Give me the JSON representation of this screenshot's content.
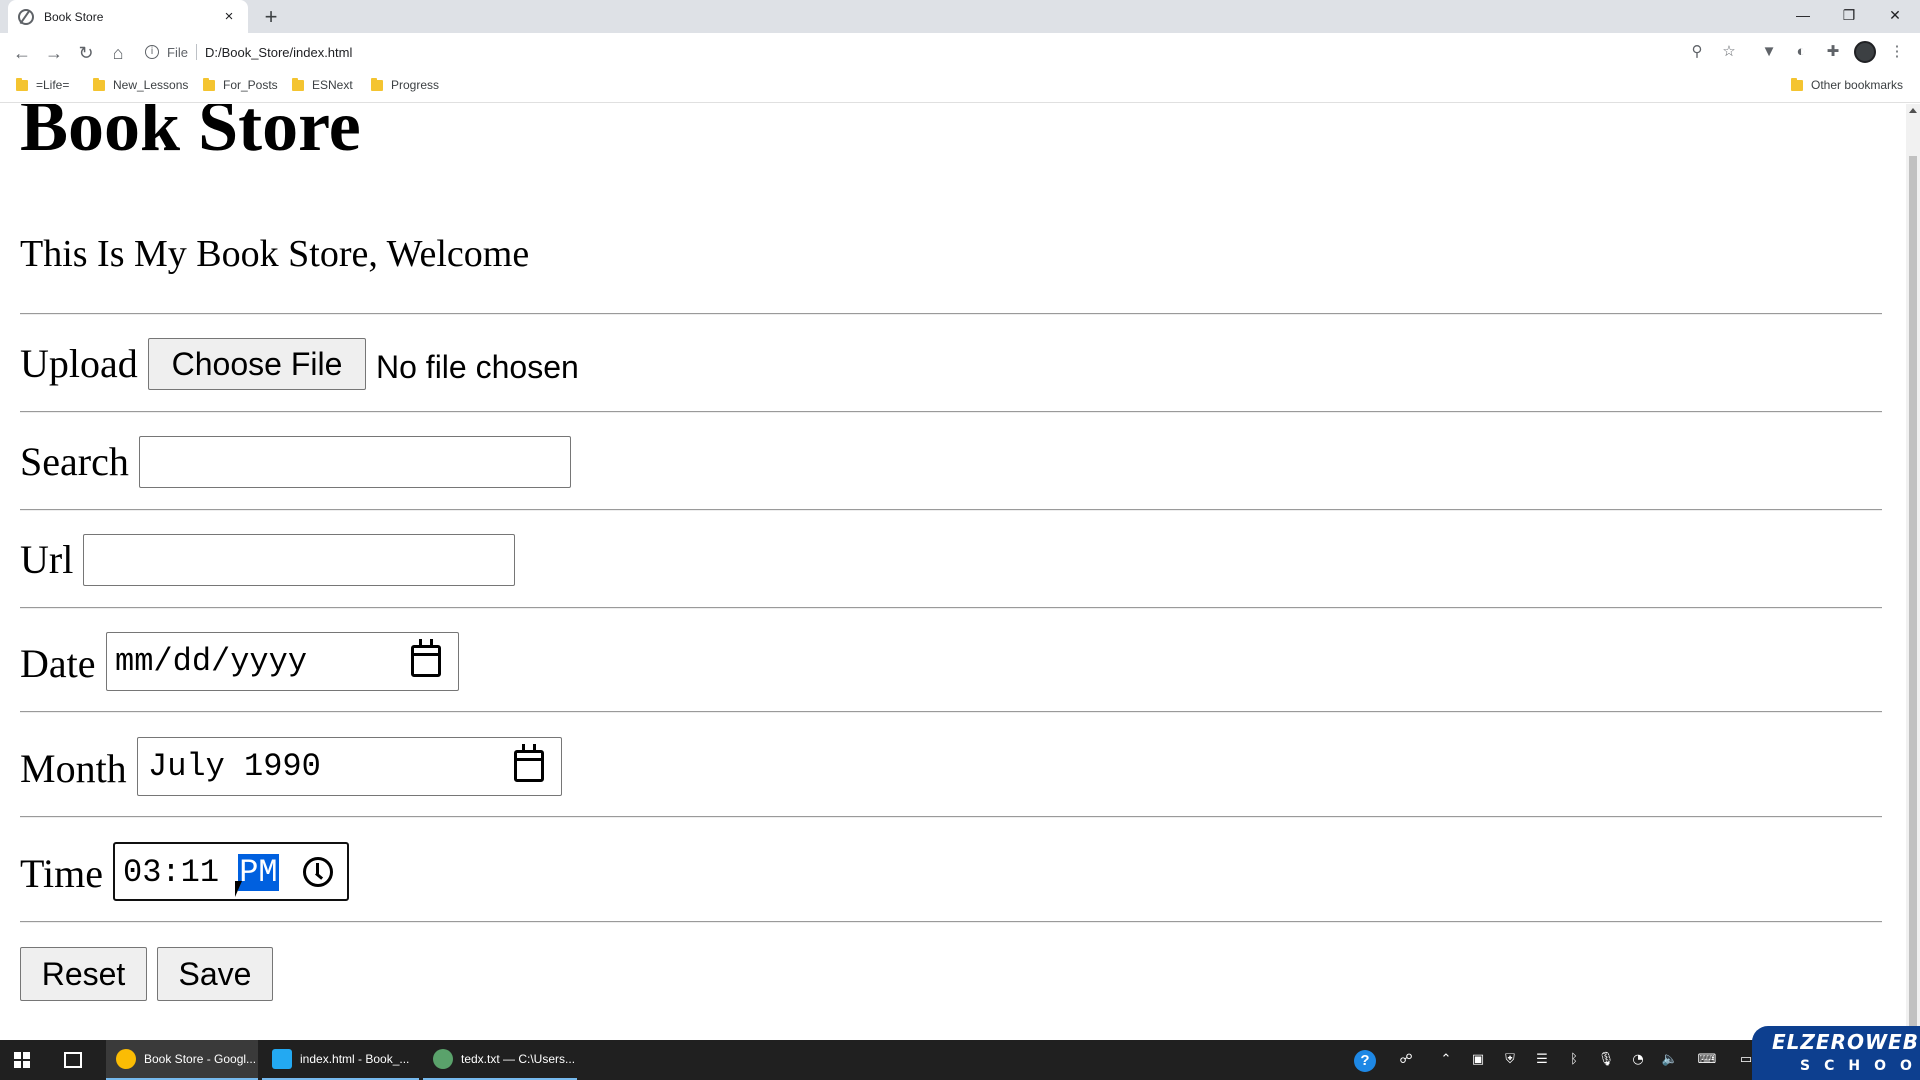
{
  "browser": {
    "tab_title": "Book Store",
    "tab_close": "×",
    "new_tab": "+",
    "window_controls": {
      "minimize": "—",
      "restore": "❐",
      "close": "✕"
    },
    "nav": {
      "back": "←",
      "forward": "→",
      "reload": "↻",
      "home": "⌂"
    },
    "address": {
      "scheme": "File",
      "url": "D:/Book_Store/index.html",
      "info_icon": "i"
    },
    "zoom_icon": "⚲",
    "star_icon": "☆",
    "extension_icons": [
      "▼",
      "◐",
      "✚"
    ],
    "menu_icon": "⋮"
  },
  "bookmarks": {
    "items": [
      "=Life=",
      "New_Lessons",
      "For_Posts",
      "ESNext",
      "Progress"
    ],
    "other": "Other bookmarks"
  },
  "page": {
    "heading": "Book Store",
    "welcome": "This Is My Book Store, Welcome",
    "upload_label": "Upload",
    "choose_file": "Choose File",
    "no_file": "No file chosen",
    "search_label": "Search",
    "url_label": "Url",
    "date_label": "Date",
    "date_placeholder": "mm/dd/yyyy",
    "month_label": "Month",
    "month_value": "July 1990",
    "time_label": "Time",
    "time_value": "03:11",
    "time_ampm": "PM",
    "reset": "Reset",
    "save": "Save"
  },
  "taskbar": {
    "items": [
      {
        "label": "Book Store - Googl...",
        "icon_color": "#fbbc04"
      },
      {
        "label": "index.html - Book_...",
        "icon_color": "#23a9f2"
      },
      {
        "label": "tedx.txt — C:\\Users...",
        "icon_color": "#5aa26b"
      }
    ],
    "help_icon": "?"
  },
  "watermark": {
    "line1": "ELZEROWEB",
    "line2": "SCHOOL"
  }
}
